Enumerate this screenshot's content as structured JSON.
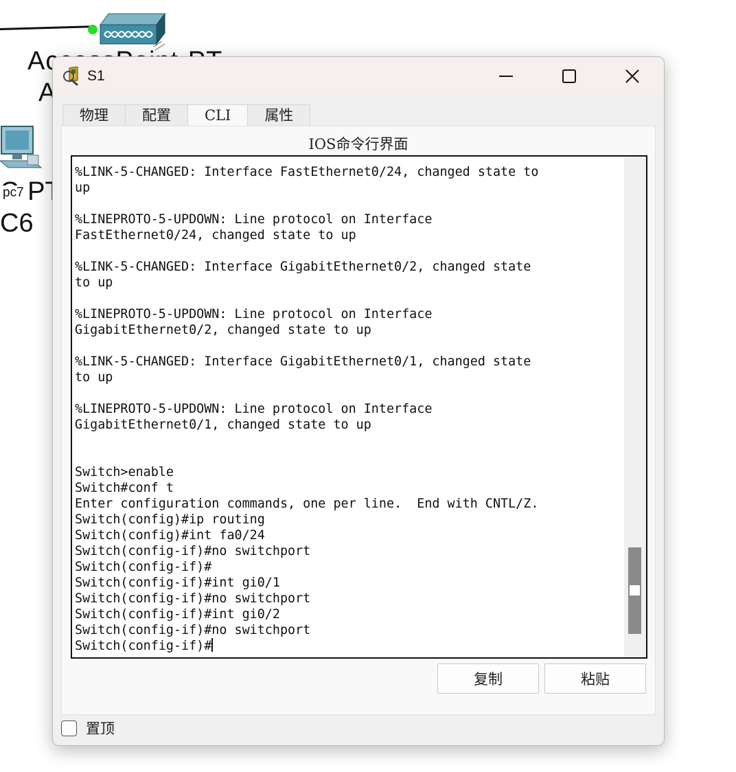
{
  "workspace": {
    "access_point_label_line1": "AccessPoint-PT",
    "access_point_label_line2": "A",
    "pc_label_type": "C-PT",
    "pc_badge": "pc7",
    "pc_label_name": "C6",
    "link_endpoint_color": "#22e02a"
  },
  "window": {
    "title": "S1",
    "icon": "packet-tracer-device-icon",
    "minimize_icon": "minimize-icon",
    "maximize_icon": "maximize-icon",
    "close_icon": "close-icon"
  },
  "tabs": [
    {
      "label": "物理",
      "active": false
    },
    {
      "label": "配置",
      "active": false
    },
    {
      "label": "CLI",
      "active": true
    },
    {
      "label": "属性",
      "active": false
    }
  ],
  "cli": {
    "panel_title": "IOS命令行界面",
    "lines": [
      "%LINK-5-CHANGED: Interface FastEthernet0/24, changed state to",
      "up",
      "",
      "%LINEPROTO-5-UPDOWN: Line protocol on Interface",
      "FastEthernet0/24, changed state to up",
      "",
      "%LINK-5-CHANGED: Interface GigabitEthernet0/2, changed state",
      "to up",
      "",
      "%LINEPROTO-5-UPDOWN: Line protocol on Interface",
      "GigabitEthernet0/2, changed state to up",
      "",
      "%LINK-5-CHANGED: Interface GigabitEthernet0/1, changed state",
      "to up",
      "",
      "%LINEPROTO-5-UPDOWN: Line protocol on Interface",
      "GigabitEthernet0/1, changed state to up",
      "",
      "",
      "Switch>enable",
      "Switch#conf t",
      "Enter configuration commands, one per line.  End with CNTL/Z.",
      "Switch(config)#ip routing",
      "Switch(config)#int fa0/24",
      "Switch(config-if)#no switchport",
      "Switch(config-if)#",
      "Switch(config-if)#int gi0/1",
      "Switch(config-if)#no switchport",
      "Switch(config-if)#int gi0/2",
      "Switch(config-if)#no switchport",
      "Switch(config-if)#"
    ],
    "scroll_position": 1.0
  },
  "buttons": {
    "copy": "复制",
    "paste": "粘贴"
  },
  "footer": {
    "always_on_top_label": "置顶",
    "always_on_top_checked": false
  }
}
